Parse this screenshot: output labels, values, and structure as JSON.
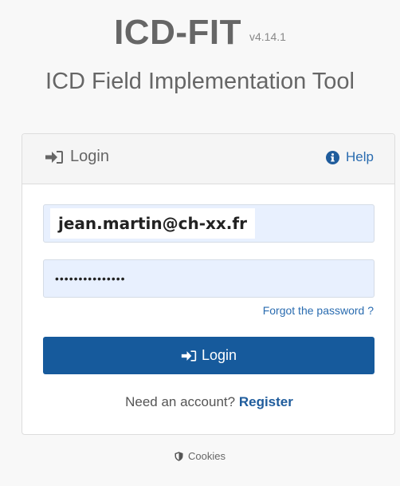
{
  "app": {
    "title": "ICD-FIT",
    "version": "v4.14.1",
    "subtitle": "ICD Field Implementation Tool"
  },
  "login_card": {
    "header_title": "Login",
    "header_icon": "sign-in-icon",
    "help_label": "Help",
    "help_icon": "info-circle-icon",
    "email_value": "jean.martin@ch-xx.fr",
    "password_mask": "•••••••••••••••",
    "forgot_label": "Forgot the password ?",
    "login_button_label": "Login",
    "register_prompt": "Need an account?",
    "register_label": "Register"
  },
  "footer": {
    "cookies_label": "Cookies",
    "cookies_icon": "shield-icon"
  },
  "colors": {
    "accent": "#165a9c",
    "link": "#2a6cb0",
    "field_background": "#e8f0fe"
  }
}
